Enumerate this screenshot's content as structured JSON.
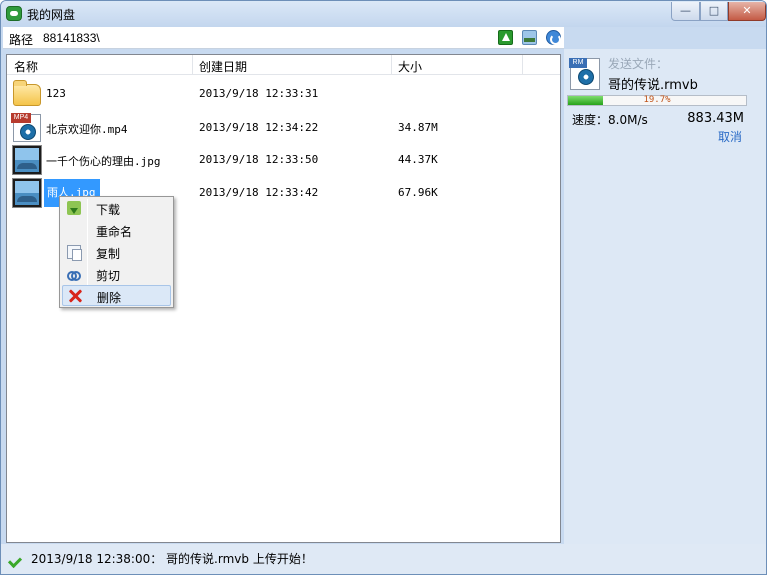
{
  "window": {
    "title": "我的网盘",
    "controls": {
      "minimize": "—",
      "maximize": "□",
      "close": "✕"
    }
  },
  "pathbar": {
    "label": "路径",
    "value": "88141833\\"
  },
  "columns": {
    "name": "名称",
    "date": "创建日期",
    "size": "大小"
  },
  "files": [
    {
      "name": "123",
      "date": "2013/9/18 12:33:31",
      "size": "",
      "icon": "folder-icon"
    },
    {
      "name": "北京欢迎你.mp4",
      "date": "2013/9/18 12:34:22",
      "size": "34.87M",
      "icon": "video-file-icon",
      "badge": "MP4"
    },
    {
      "name": "一千个伤心的理由.jpg",
      "date": "2013/9/18 12:33:50",
      "size": "44.37K",
      "icon": "image-file-icon"
    },
    {
      "name": "雨人.jpg",
      "date": "2013/9/18 12:33:42",
      "size": "67.96K",
      "icon": "image-file-icon"
    }
  ],
  "context_menu": {
    "items": [
      {
        "label": "下载",
        "icon": "download-icon"
      },
      {
        "label": "重命名",
        "icon": ""
      },
      {
        "label": "复制",
        "icon": "copy-icon"
      },
      {
        "label": "剪切",
        "icon": "cut-icon"
      },
      {
        "label": "删除",
        "icon": "delete-icon"
      }
    ]
  },
  "transfer": {
    "heading": "发送文件：",
    "badge": "RM",
    "filename": "哥的传说.rmvb",
    "progress_percent": 19.7,
    "progress_label": "19.7%",
    "speed": "速度：8.0M/s",
    "size": "883.43M",
    "cancel": "取消"
  },
  "status": {
    "message": "2013/9/18 12:38:00： 哥的传说.rmvb 上传开始！"
  },
  "colors": {
    "selection": "#3399ff",
    "cancel_link": "#2a6bc6",
    "progress_fill": "#27a31a"
  }
}
